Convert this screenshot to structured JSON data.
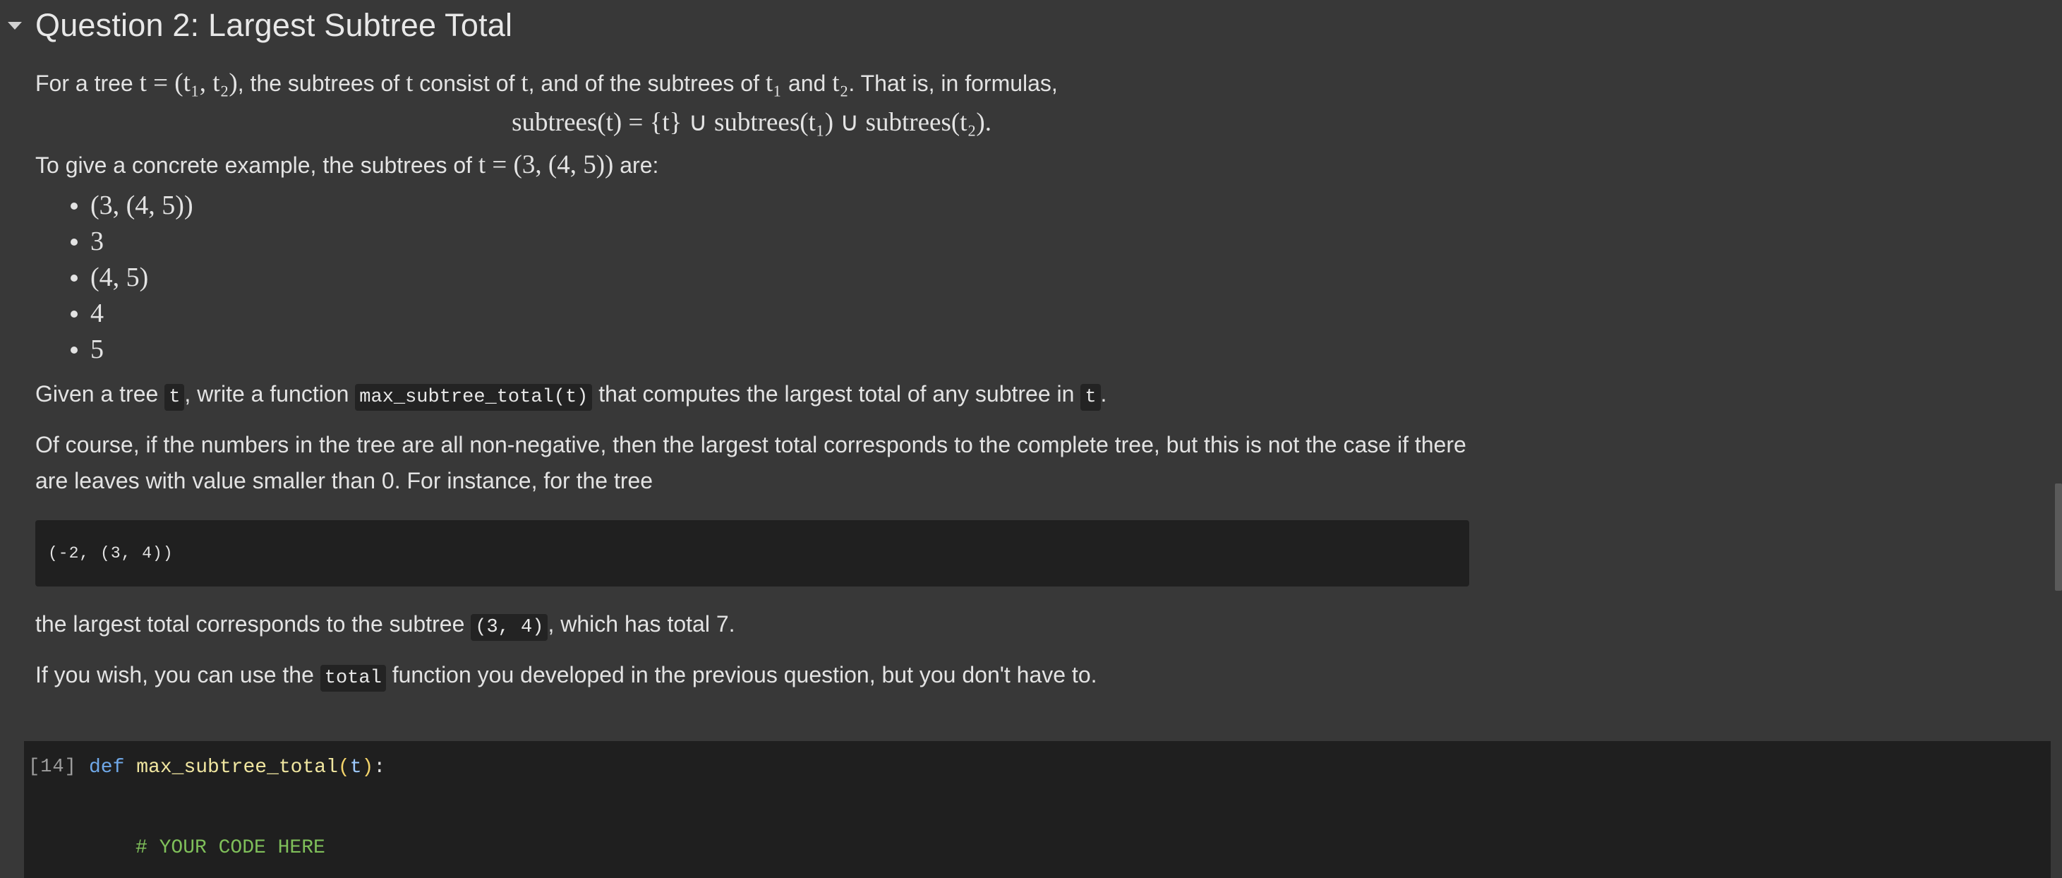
{
  "section": {
    "title": "Question 2: Largest Subtree Total",
    "toggle_icon": "caret-down-icon"
  },
  "intro": {
    "text_1": "For a tree ",
    "math_1": "t = (t₁, t₂)",
    "text_2": ", the subtrees of ",
    "math_2": "t",
    "text_3": " consist of ",
    "math_3": "t",
    "text_4": ", and of the subtrees of ",
    "math_4": "t₁",
    "text_5": " and ",
    "math_5": "t₂",
    "text_6": ". That is, in formulas,"
  },
  "formula": "subtrees(t) = {t} ∪ subtrees(t₁) ∪ subtrees(t₂).",
  "example": {
    "text_1": "To give a concrete example, the subtrees of ",
    "math": "t = (3, (4, 5))",
    "text_2": " are:"
  },
  "subtrees": [
    "(3, (4, 5))",
    "3",
    "(4, 5)",
    "4",
    "5"
  ],
  "task": {
    "text_1": "Given a tree ",
    "code_1": "t",
    "text_2": ", write a function ",
    "code_2": "max_subtree_total(t)",
    "text_3": " that computes the largest total of any subtree in ",
    "code_3": "t",
    "text_4": "."
  },
  "note": "Of course, if the numbers in the tree are all non-negative, then the largest total corresponds to the complete tree, but this is not the case if there are leaves with value smaller than 0. For instance, for the tree",
  "code_block": "(-2, (3, 4))",
  "result": {
    "text_1": "the largest total corresponds to the subtree ",
    "code": "(3, 4)",
    "text_2": ", which has total 7."
  },
  "hint": {
    "text_1": "If you wish, you can use the ",
    "code": "total",
    "text_2": " function you developed in the previous question, but you don't have to."
  },
  "code_cell": {
    "exec_count": "[14]",
    "kw_def": "def",
    "fn_name": "max_subtree_total",
    "paren_open": "(",
    "param": "t",
    "paren_close": ")",
    "colon": ":",
    "comment": "# YOUR CODE HERE"
  },
  "colors": {
    "background": "#383838",
    "code_background": "#1f1f1f",
    "keyword": "#6fa8e8",
    "function_name": "#f0e6a0",
    "comment": "#7fbf5a"
  }
}
